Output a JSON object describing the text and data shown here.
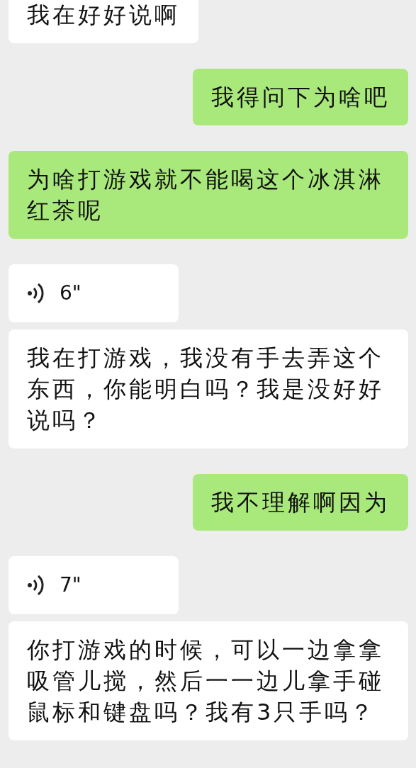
{
  "messages": [
    {
      "sent": false,
      "kind": "text",
      "text": "我在好好说啊"
    },
    {
      "sent": true,
      "kind": "text",
      "text": "我得问下为啥吧"
    },
    {
      "sent": true,
      "kind": "text",
      "text": "为啥打游戏就不能喝这个冰淇淋红茶呢"
    },
    {
      "sent": false,
      "kind": "voice",
      "text": "6\""
    },
    {
      "sent": false,
      "kind": "text",
      "text": "我在打游戏，我没有手去弄这个东西，你能明白吗？我是没好好说吗？"
    },
    {
      "sent": true,
      "kind": "text",
      "text": "我不理解啊因为"
    },
    {
      "sent": false,
      "kind": "voice",
      "text": "7\""
    },
    {
      "sent": false,
      "kind": "text",
      "text": "你打游戏的时候，可以一边拿拿吸管儿搅，然后一一边儿拿手碰鼠标和键盘吗？我有3只手吗？"
    }
  ]
}
